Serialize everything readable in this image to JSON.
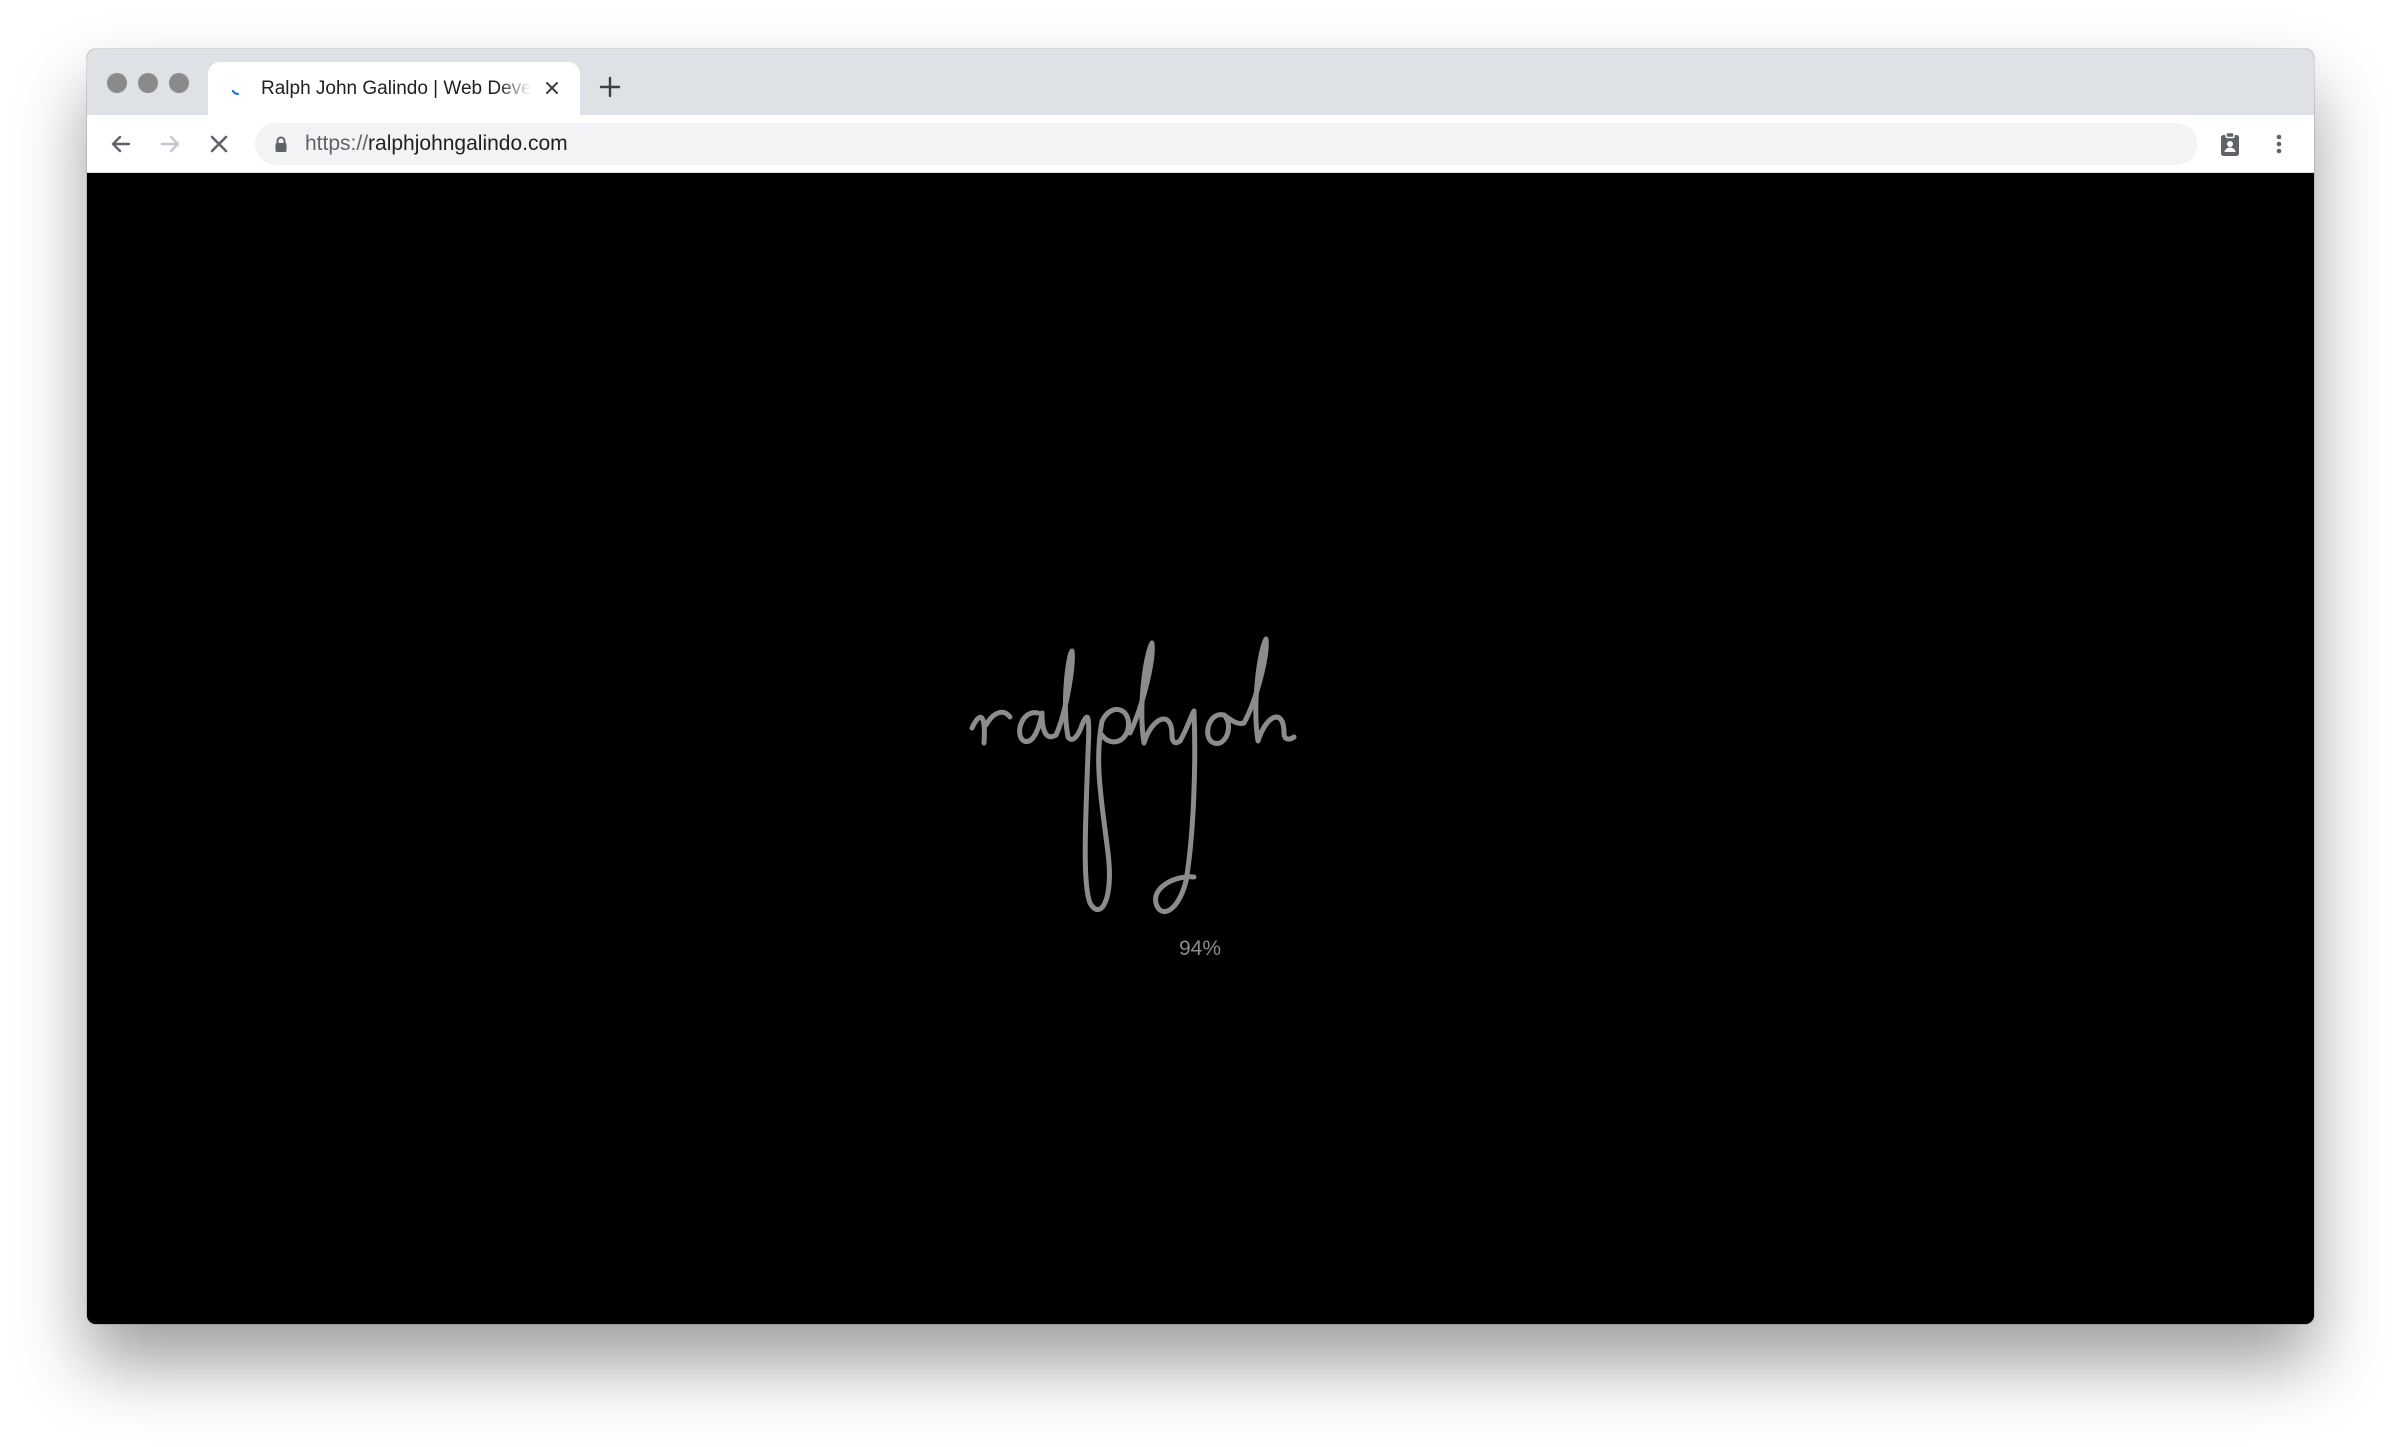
{
  "browser": {
    "tab": {
      "title": "Ralph John Galindo | Web Developer",
      "loading": true
    },
    "address_bar": {
      "scheme": "https://",
      "host": "ralphjohngalindo.com"
    },
    "toolbar": {
      "back_icon": "arrow-left-icon",
      "forward_icon": "arrow-right-icon",
      "stop_icon": "close-icon",
      "extension_icon": "clipboard-badge-icon",
      "menu_icon": "kebab-menu-icon"
    },
    "colors": {
      "tabstrip": "#dee1e6",
      "spinner": "#1a73e8"
    }
  },
  "page": {
    "preloader": {
      "logo_signature": "ralphjoh",
      "progress_text": "94%",
      "progress": 0.94,
      "background": "#000000",
      "logo_color": "#8c8c8c"
    }
  }
}
